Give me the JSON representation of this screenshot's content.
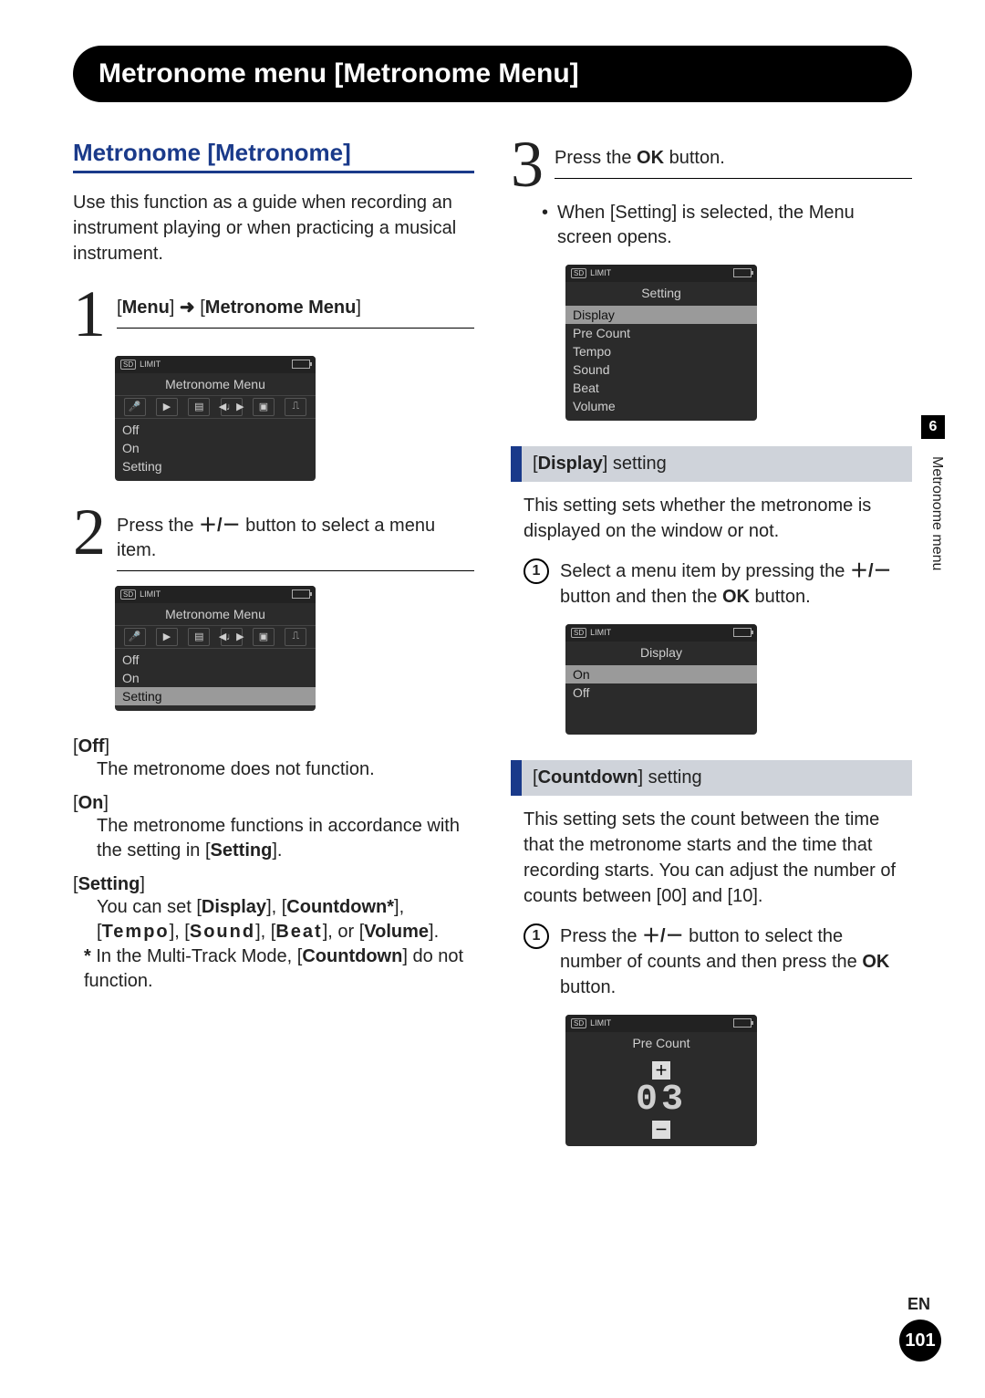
{
  "chapter_bar": "Metronome menu [Metronome Menu]",
  "side": {
    "chapter_number": "6",
    "side_label": "Metronome menu",
    "lang": "EN",
    "page": "101"
  },
  "left": {
    "section_title": "Metronome [Metronome]",
    "intro": "Use this function as a guide when recording an instrument playing or when practicing a musical instrument.",
    "step1": {
      "num": "1",
      "pre": "[",
      "menu_b": "Menu",
      "mid": "] ",
      "arrow": "➜",
      "post": " [",
      "metmenu_b": "Metronome Menu",
      "end": "]"
    },
    "lcd1": {
      "title": "Metronome Menu",
      "items": [
        "Off",
        "On",
        "Setting"
      ],
      "selected_index": -1
    },
    "step2": {
      "num": "2",
      "t1": "Press the ",
      "pm": "＋/－",
      "t2": " button to select a menu item."
    },
    "lcd2": {
      "title": "Metronome Menu",
      "items": [
        "Off",
        "On",
        "Setting"
      ],
      "selected_index": 2
    },
    "defs": {
      "off_term_pre": "[",
      "off_b": "Off",
      "off_term_post": "]",
      "off_body": "The metronome does not function.",
      "on_term_pre": "[",
      "on_b": "On",
      "on_term_post": "]",
      "on_body_1": "The metronome functions in accordance with the setting in [",
      "on_body_b": "Setting",
      "on_body_2": "].",
      "set_term_pre": "[",
      "set_b": "Setting",
      "set_term_post": "]",
      "set_body_1": "You can set [",
      "set_disp": "Display",
      "set_body_2": "], [",
      "set_cd": "Countdown*",
      "set_body_3": "], [",
      "set_tempo": "Tempo",
      "set_body_4": "], [",
      "set_sound": "Sound",
      "set_body_5": "], [",
      "set_beat": "Beat",
      "set_body_6": "], or [",
      "set_vol": "Volume",
      "set_body_7": "].",
      "note_star": "*",
      "note_1": " In the Multi-Track Mode, [",
      "note_cd": "Countdown",
      "note_2": "] do not function."
    }
  },
  "right": {
    "step3": {
      "num": "3",
      "t1": "Press the ",
      "ok": "OK",
      "t2": " button."
    },
    "bullet": {
      "t1": "When [",
      "b": "Setting",
      "t2": "] is selected, the Menu screen opens."
    },
    "lcd_setting": {
      "title": "Setting",
      "items": [
        "Display",
        "Pre Count",
        "Tempo",
        "Sound",
        "Beat",
        "Volume"
      ],
      "selected_index": 0
    },
    "display_setting": {
      "header_pre": "[",
      "header_b": "Display",
      "header_post": "] setting",
      "body": "This setting sets whether the metronome is displayed on the window or not.",
      "step_t1": "Select a menu item by pressing the ",
      "step_pm": "＋/－",
      "step_t2": " button and then the ",
      "step_ok": "OK",
      "step_t3": " button."
    },
    "lcd_display": {
      "title": "Display",
      "items": [
        "On",
        "Off"
      ],
      "selected_index": 0
    },
    "countdown_setting": {
      "header_pre": "[",
      "header_b": "Countdown",
      "header_post": "] setting",
      "body_1": "This setting sets the count between the time that the metronome starts and the time that recording starts. You can adjust the number of counts between [",
      "body_b1": "00",
      "body_2": "] and [",
      "body_b2": "10",
      "body_3": "].",
      "step_t1": "Press the ",
      "step_pm": "＋/－",
      "step_t2": " button to select the number of counts and then press the ",
      "step_ok": "OK",
      "step_t3": " button."
    },
    "lcd_precount": {
      "title": "Pre Count",
      "value": "03",
      "plus": "＋",
      "minus": "－"
    }
  },
  "lcd_status": {
    "sd": "SD",
    "limit": "LIMIT"
  }
}
